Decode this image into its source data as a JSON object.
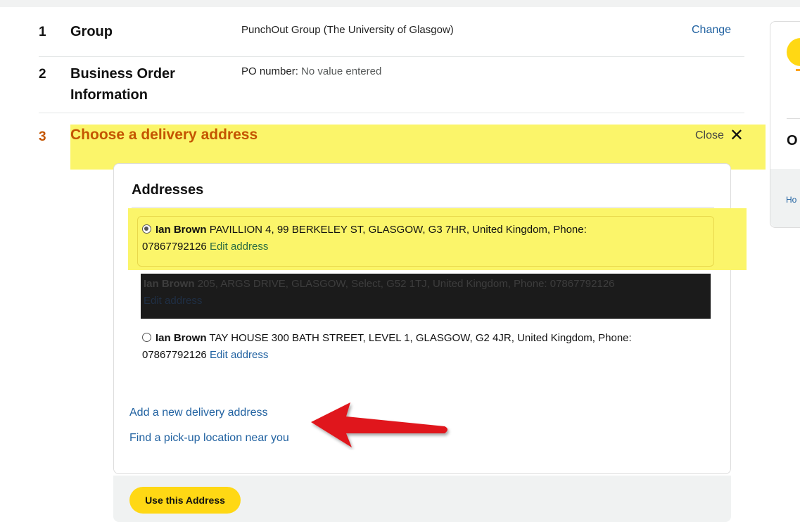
{
  "steps": [
    {
      "num": "1",
      "title": "Group",
      "value": "PunchOut Group (The University of Glasgow)",
      "action": "Change"
    },
    {
      "num": "2",
      "title_line1": "Business Order",
      "title_line2": "Information",
      "value_label": "PO number:",
      "value": "No value entered"
    },
    {
      "num": "3",
      "title": "Choose a delivery address",
      "action": "Close"
    }
  ],
  "addresses": {
    "heading": "Addresses",
    "items": [
      {
        "name": "Ian Brown",
        "line1": "PAVILLION 4, 99 BERKELEY ST, GLASGOW, G3 7HR, United Kingdom, Phone:",
        "line2": "07867792126",
        "edit": "Edit address",
        "selected": true
      },
      {
        "name": "Ian Brown",
        "line1": "205, ARGS DRIVE, GLASGOW, Select, G52 1TJ, United Kingdom, Phone: 07867792126",
        "edit": "Edit address",
        "selected": false,
        "redacted": true
      },
      {
        "name": "Ian Brown",
        "line1": "TAY HOUSE 300 BATH STREET, LEVEL 1, GLASGOW, G2 4JR, United Kingdom, Phone:",
        "line2": "07867792126",
        "edit": "Edit address",
        "selected": false
      }
    ],
    "add_link": "Add a new delivery address",
    "pickup_link": "Find a pick-up location near you",
    "use_button": "Use this Address"
  },
  "right_panel": {
    "heading_fragment": "O",
    "link_fragment": "Ho"
  },
  "colors": {
    "highlight": "#fbf56a",
    "link": "#2162a1",
    "step_active": "#c45500",
    "button": "#ffd814",
    "arrow": "#e0191b"
  }
}
